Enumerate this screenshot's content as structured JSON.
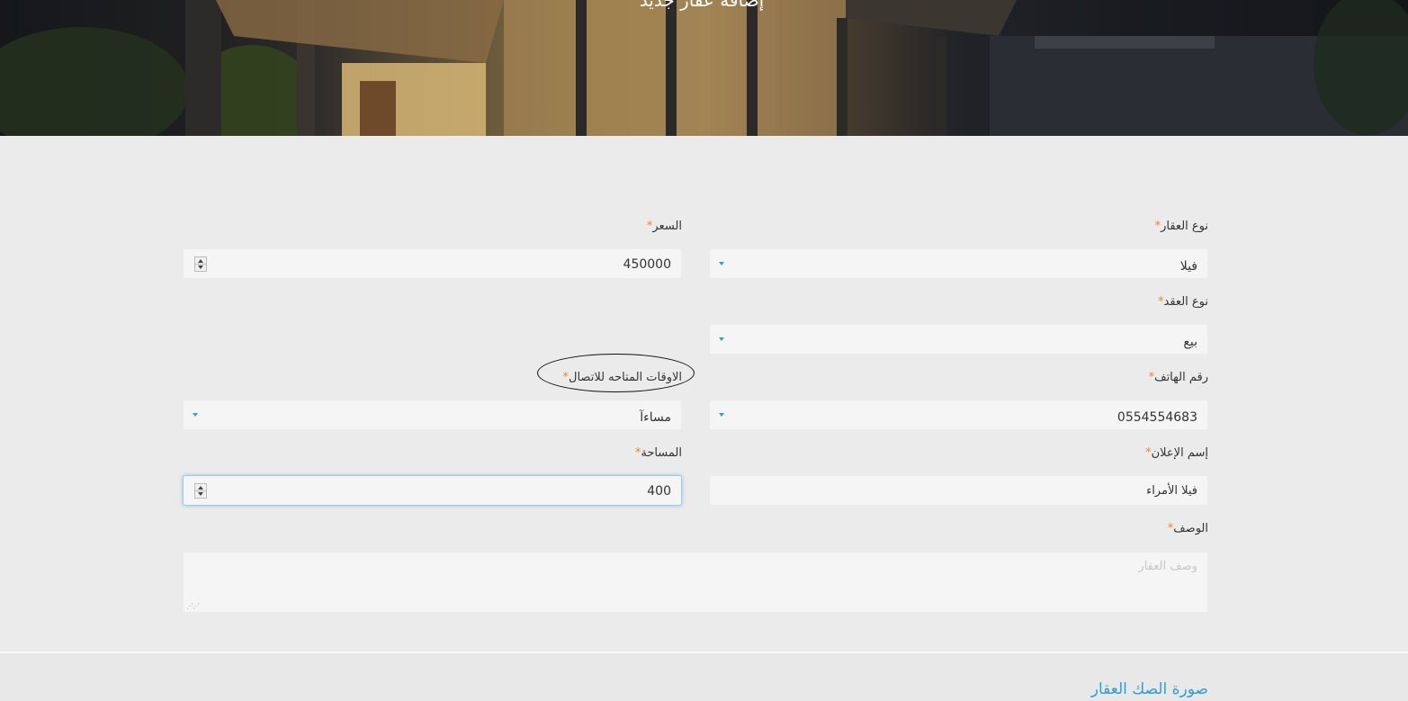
{
  "hero": {
    "title": "إضافة عقار جديد"
  },
  "form": {
    "property_type": {
      "label": "نوع العقار",
      "value": "فيلا"
    },
    "price": {
      "label": "السعر",
      "value": "450000"
    },
    "contract_type": {
      "label": "نوع العقد",
      "value": "بيع"
    },
    "phone": {
      "label": "رقم الهاتف",
      "value": "0554554683"
    },
    "contact_times": {
      "label": "الاوقات المتاحه للاتصال",
      "value": "مساءآ"
    },
    "ad_name": {
      "label": "إسم الإعلان",
      "value": "فيلا الأمراء"
    },
    "area": {
      "label": "المساحة",
      "value": "400"
    },
    "description": {
      "label": "الوصف",
      "placeholder": "وصف العقار"
    },
    "required_mark": "*"
  },
  "deed_section": {
    "title": "صورة الصك العقار"
  },
  "colors": {
    "accent": "#2e9ed8",
    "required": "#f0862b",
    "background": "#ebebeb"
  }
}
